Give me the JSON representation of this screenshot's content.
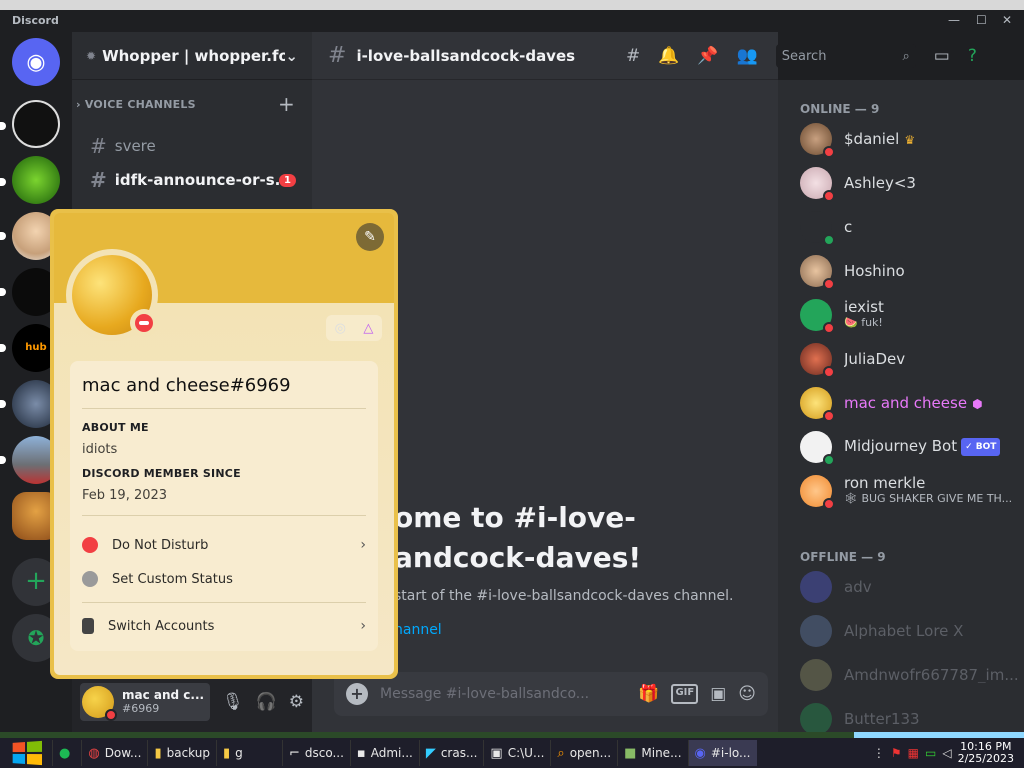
{
  "window": {
    "title_partial": "Minecraft",
    "app_name": "Discord"
  },
  "server": {
    "name": "Whopper | whopper.fo..."
  },
  "sidebar": {
    "category": "VOICE CHANNELS",
    "channels": [
      {
        "name": "svere",
        "unread": false,
        "badge": ""
      },
      {
        "name": "idfk-announce-or-s...",
        "unread": true,
        "badge": "1"
      }
    ]
  },
  "user_panel": {
    "name": "mac and c...",
    "tag": "#6969"
  },
  "channel": {
    "name": "i-love-ballsandcock-daves",
    "welcome_title": "ome to #i-love-\nandcock-daves!",
    "welcome_sub": " start of the #i-love-ballsandcock-daves channel.",
    "welcome_link": "hannel",
    "composer_placeholder": "Message #i-love-ballsandco..."
  },
  "header": {
    "search_placeholder": "Search"
  },
  "members": {
    "online_header": "ONLINE — 9",
    "offline_header": "OFFLINE — 9",
    "online": [
      {
        "name": "$daniel",
        "activity": "",
        "color": "#dbdee1",
        "status": "#f23f43",
        "crown": true
      },
      {
        "name": "Ashley<3",
        "activity": "",
        "color": "#dbdee1",
        "status": "#f23f43"
      },
      {
        "name": "c",
        "activity": "",
        "color": "#dbdee1",
        "status": "#23a55a"
      },
      {
        "name": "Hoshino",
        "activity": "",
        "color": "#dbdee1",
        "status": "#f23f43"
      },
      {
        "name": "iexist",
        "activity": "🍉 fuk!",
        "color": "#dbdee1",
        "status": "#f23f43"
      },
      {
        "name": "JuliaDev",
        "activity": "",
        "color": "#dbdee1",
        "status": "#f23f43"
      },
      {
        "name": "mac and cheese",
        "activity": "",
        "color": "#e879f9",
        "status": "#f23f43"
      },
      {
        "name": "Midjourney Bot",
        "activity": "",
        "color": "#dbdee1",
        "status": "#23a55a",
        "bot": "✓ BOT"
      },
      {
        "name": "ron merkle",
        "activity": "🕸 BUG SHAKER GIVE ME TH...",
        "color": "#dbdee1",
        "status": "#f23f43"
      }
    ],
    "offline": [
      {
        "name": "adv"
      },
      {
        "name": "Alphabet Lore X"
      },
      {
        "name": "Amdnwofr667787_im..."
      },
      {
        "name": "Butter133"
      }
    ]
  },
  "profile": {
    "username": "mac and cheese",
    "discriminator": "#6969",
    "about_label": "ABOUT ME",
    "about_text": "idiots",
    "since_label": "DISCORD MEMBER SINCE",
    "since_text": "Feb 19, 2023",
    "menu": [
      {
        "label": "Do Not Disturb",
        "chevron": true
      },
      {
        "label": "Set Custom Status",
        "chevron": false
      },
      {
        "label": "Switch Accounts",
        "chevron": true
      }
    ]
  },
  "taskbar": {
    "items": [
      "Dow...",
      "backup",
      "g",
      "dsco...",
      "Admi...",
      "cras...",
      "C:\\U...",
      "open...",
      "Mine...",
      "#i-lo..."
    ],
    "time": "10:16 PM",
    "date": "2/25/2023"
  },
  "colors": {
    "accent": "#5865f2",
    "dnd": "#f23f43",
    "online": "#23a55a",
    "profile_gold": "#e9c049"
  }
}
